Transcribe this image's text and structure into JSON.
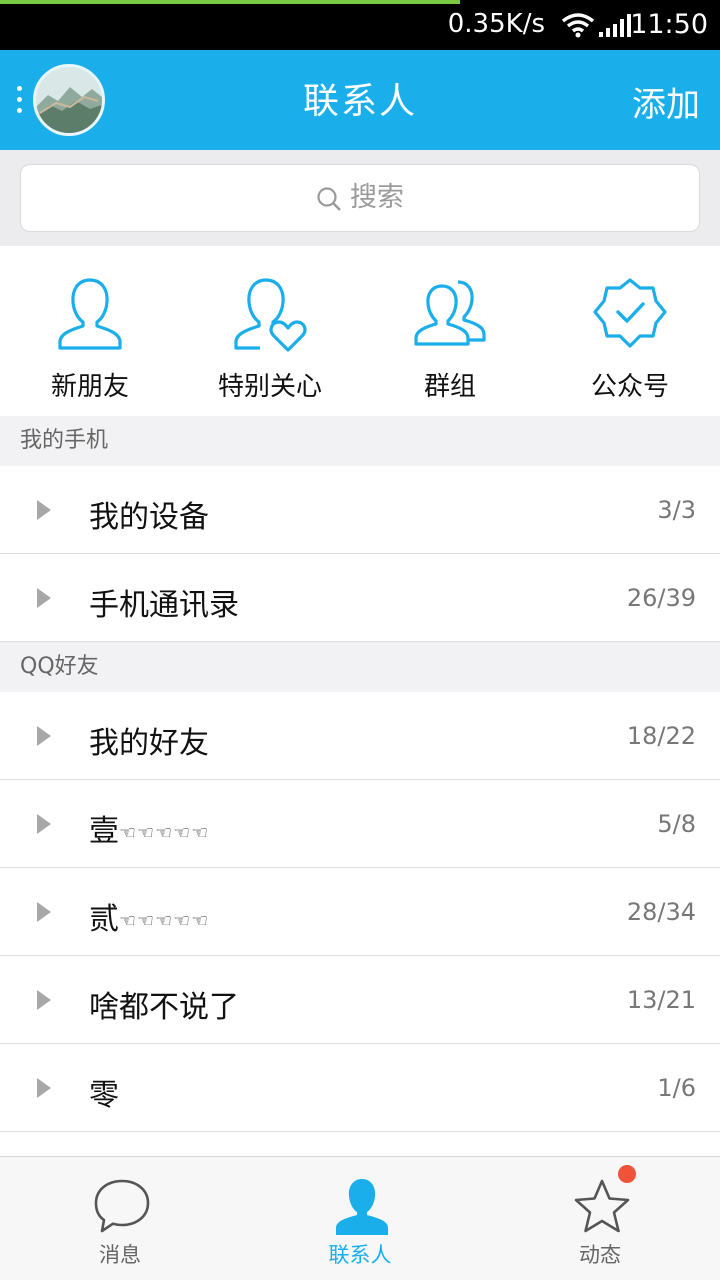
{
  "status_bar": {
    "net_speed": "0.35K/s",
    "time": "11:50"
  },
  "header": {
    "title": "联系人",
    "add_label": "添加"
  },
  "search": {
    "placeholder": "搜索"
  },
  "quick_actions": [
    {
      "label": "新朋友",
      "icon": "person-icon"
    },
    {
      "label": "特别关心",
      "icon": "person-heart-icon"
    },
    {
      "label": "群组",
      "icon": "group-icon"
    },
    {
      "label": "公众号",
      "icon": "verified-badge-icon"
    }
  ],
  "sections": [
    {
      "title": "我的手机",
      "groups": [
        {
          "name": "我的设备",
          "count": "3/3"
        },
        {
          "name": "手机通讯录",
          "count": "26/39"
        }
      ]
    },
    {
      "title": "QQ好友",
      "groups": [
        {
          "name": "我的好友",
          "count": "18/22"
        },
        {
          "name": "壹",
          "deco": "☜☜☜☜☜",
          "count": "5/8"
        },
        {
          "name": "贰",
          "deco": "☜☜☜☜☜",
          "count": "28/34"
        },
        {
          "name": "啥都不说了",
          "count": "13/21"
        },
        {
          "name": "零",
          "count": "1/6"
        }
      ]
    }
  ],
  "tabs": [
    {
      "label": "消息",
      "icon": "chat-bubble-icon"
    },
    {
      "label": "联系人",
      "icon": "contacts-icon",
      "active": true
    },
    {
      "label": "动态",
      "icon": "star-icon",
      "badge": true
    }
  ],
  "colors": {
    "accent": "#1aaeea",
    "badge": "#f0523a",
    "status_bar_progress": "#7ac943"
  }
}
